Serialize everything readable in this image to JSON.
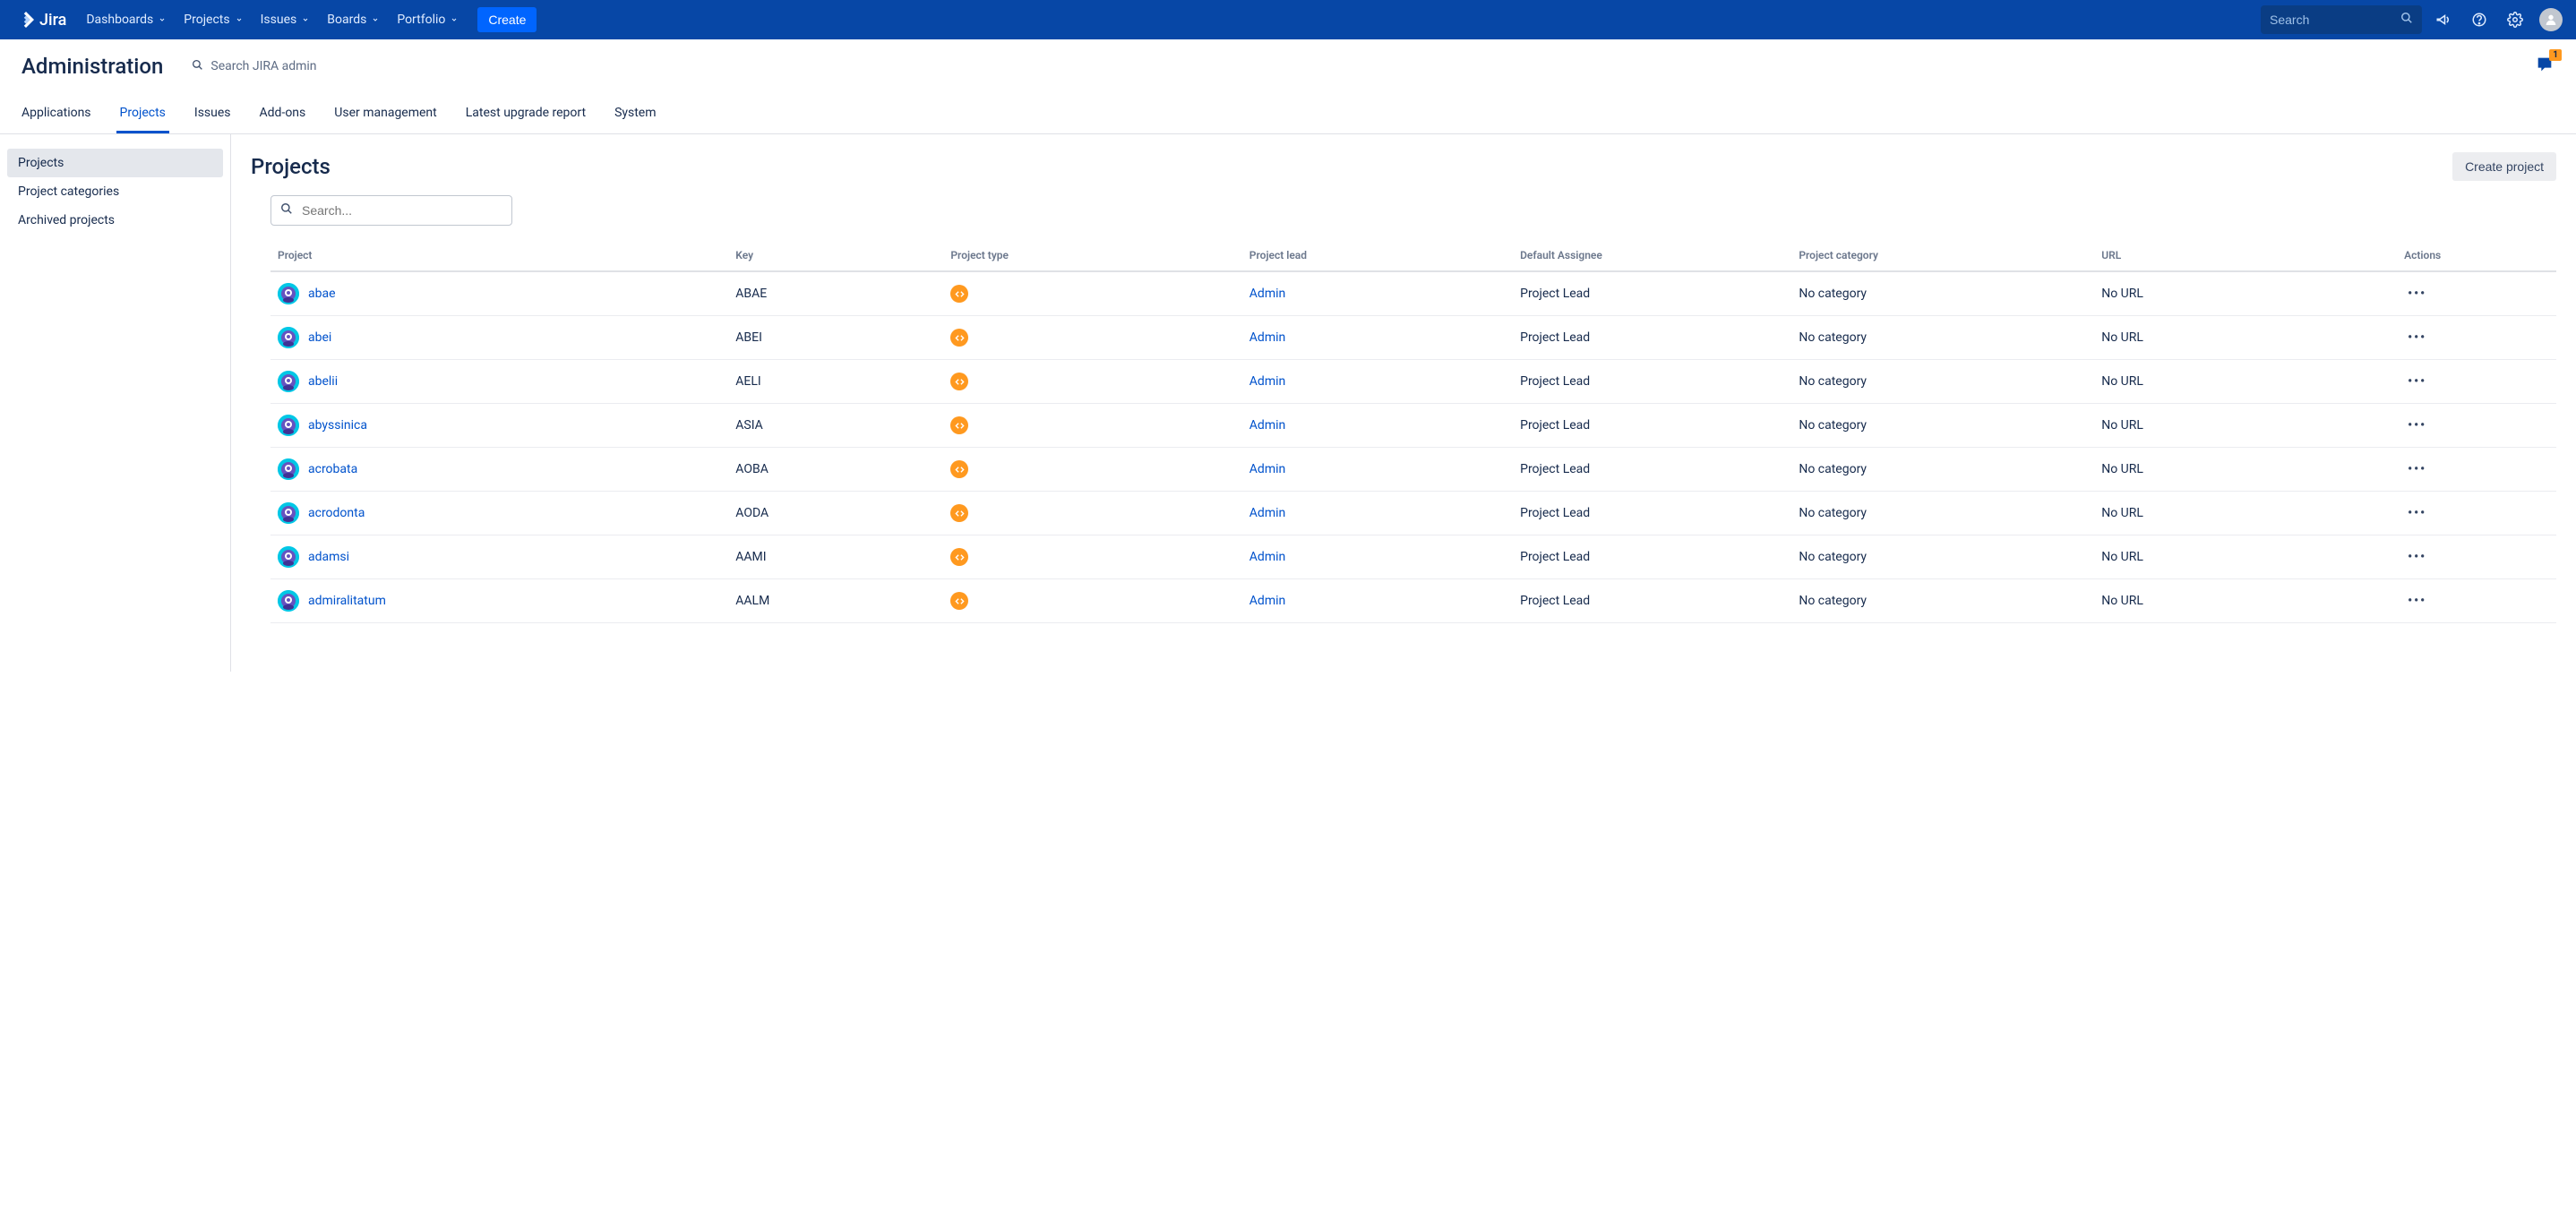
{
  "topnav": {
    "product": "Jira",
    "items": [
      "Dashboards",
      "Projects",
      "Issues",
      "Boards",
      "Portfolio"
    ],
    "create": "Create",
    "search_placeholder": "Search"
  },
  "admin": {
    "title": "Administration",
    "search_label": "Search JIRA admin",
    "feedback_badge": "1",
    "tabs": [
      "Applications",
      "Projects",
      "Issues",
      "Add-ons",
      "User management",
      "Latest upgrade report",
      "System"
    ],
    "active_tab": 1
  },
  "sidebar": {
    "items": [
      "Projects",
      "Project categories",
      "Archived projects"
    ],
    "active": 0
  },
  "page": {
    "title": "Projects",
    "create_button": "Create project",
    "search_placeholder": "Search..."
  },
  "table": {
    "headers": [
      "Project",
      "Key",
      "Project type",
      "Project lead",
      "Default Assignee",
      "Project category",
      "URL",
      "Actions"
    ],
    "rows": [
      {
        "name": "abae",
        "key": "ABAE",
        "lead": "Admin",
        "assignee": "Project Lead",
        "category": "No category",
        "url": "No URL"
      },
      {
        "name": "abei",
        "key": "ABEI",
        "lead": "Admin",
        "assignee": "Project Lead",
        "category": "No category",
        "url": "No URL"
      },
      {
        "name": "abelii",
        "key": "AELI",
        "lead": "Admin",
        "assignee": "Project Lead",
        "category": "No category",
        "url": "No URL"
      },
      {
        "name": "abyssinica",
        "key": "ASIA",
        "lead": "Admin",
        "assignee": "Project Lead",
        "category": "No category",
        "url": "No URL"
      },
      {
        "name": "acrobata",
        "key": "AOBA",
        "lead": "Admin",
        "assignee": "Project Lead",
        "category": "No category",
        "url": "No URL"
      },
      {
        "name": "acrodonta",
        "key": "AODA",
        "lead": "Admin",
        "assignee": "Project Lead",
        "category": "No category",
        "url": "No URL"
      },
      {
        "name": "adamsi",
        "key": "AAMI",
        "lead": "Admin",
        "assignee": "Project Lead",
        "category": "No category",
        "url": "No URL"
      },
      {
        "name": "admiralitatum",
        "key": "AALM",
        "lead": "Admin",
        "assignee": "Project Lead",
        "category": "No category",
        "url": "No URL"
      }
    ]
  }
}
